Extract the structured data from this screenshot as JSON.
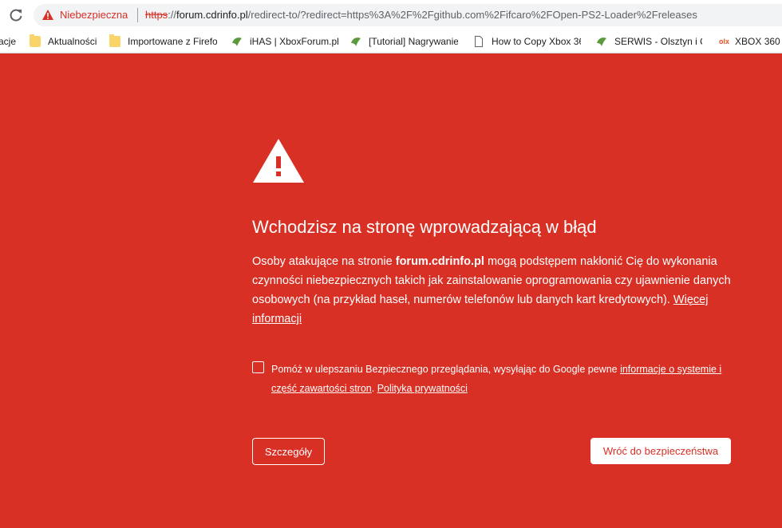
{
  "toolbar": {
    "security_label": "Niebezpieczna",
    "url_scheme": "https",
    "url_sep": "://",
    "url_host": "forum.cdrinfo.pl",
    "url_path": "/redirect-to/?redirect=https%3A%2F%2Fgithub.com%2Fifcaro%2FOpen-PS2-Loader%2Freleases"
  },
  "bookmarks": [
    {
      "label": "acje"
    },
    {
      "label": "Aktualności"
    },
    {
      "label": "Importowane z Firefo"
    },
    {
      "label": "iHAS | XboxForum.pl"
    },
    {
      "label": "[Tutorial] Nagrywanie"
    },
    {
      "label": "How to Copy Xbox 36"
    },
    {
      "label": "SERWIS - Olsztyn i Ol"
    },
    {
      "label": "olx",
      "label2": "XBOX 360"
    }
  ],
  "interstitial": {
    "heading": "Wchodzisz na stronę wprowadzającą w błąd",
    "body_pre": "Osoby atakujące na stronie ",
    "body_site": "forum.cdrinfo.pl",
    "body_post": " mogą podstępem nakłonić Cię do wykonania czynności niebezpiecznych takich jak zainstalowanie oprogramowania czy ujawnienie danych osobowych (na przykład haseł, numerów telefonów lub danych kart kredytowych). ",
    "learn_more": "Więcej informacji",
    "optin_text": "Pomóż w ulepszaniu Bezpiecznego przeglądania, wysyłając do Google pewne ",
    "optin_link": "informacje o systemie i część zawartości stron",
    "optin_dot": ". ",
    "privacy_link": "Polityka prywatności",
    "details_button": "Szczegóły",
    "back_button": "Wróć do bezpieczeństwa"
  },
  "colors": {
    "danger_red": "#d93025",
    "text_white": "#ffffff"
  },
  "icons": [
    "reload-icon",
    "warning-icon",
    "folder-icon",
    "page-icon",
    "xbox-leaf-icon",
    "olx-icon"
  ]
}
